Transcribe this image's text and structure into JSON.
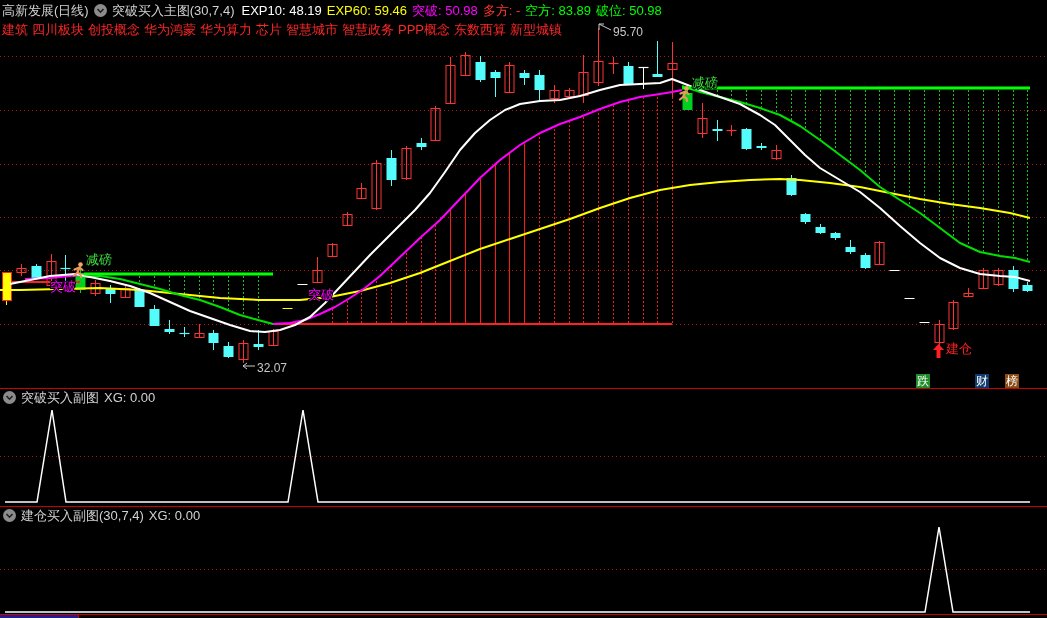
{
  "header": {
    "title": "高新发展(日线)",
    "indicator": "突破买入主图(30,7,4)",
    "values": [
      {
        "label": "EXP10: 48.19",
        "color": "#ffffff"
      },
      {
        "label": "EXP60: 59.46",
        "color": "#ffff00"
      },
      {
        "label": "突破: 50.98",
        "color": "#ff00ff"
      },
      {
        "label": "多方: -",
        "color": "#ff3232"
      },
      {
        "label": "空方: 83.89",
        "color": "#00ff00"
      },
      {
        "label": "破位: 50.98",
        "color": "#00ff00"
      }
    ]
  },
  "tags": [
    "建筑",
    "四川板块",
    "创投概念",
    "华为鸿蒙",
    "华为算力",
    "芯片",
    "智慧城市",
    "智慧政务",
    "PPP概念",
    "东数西算",
    "新型城镇"
  ],
  "main_chart": {
    "high_label": "95.70",
    "low_label": "32.07",
    "signals": [
      {
        "kind": "reduce",
        "text": "减磅"
      },
      {
        "kind": "breakout",
        "text": "突破"
      },
      {
        "kind": "breakout",
        "text": "突破"
      },
      {
        "kind": "reduce",
        "text": "减磅"
      },
      {
        "kind": "build",
        "text": "建仓"
      }
    ]
  },
  "badges": [
    {
      "text": "跌",
      "color": "#1e8c28"
    },
    {
      "text": "财",
      "color": "#0e3a6e"
    },
    {
      "text": "榜",
      "color": "#8c4a14"
    }
  ],
  "sub_charts": [
    {
      "title": "突破买入副图",
      "reading": "XG: 0.00"
    },
    {
      "title": "建仓买入副图(30,7,4)",
      "reading": "XG: 0.00"
    }
  ]
}
